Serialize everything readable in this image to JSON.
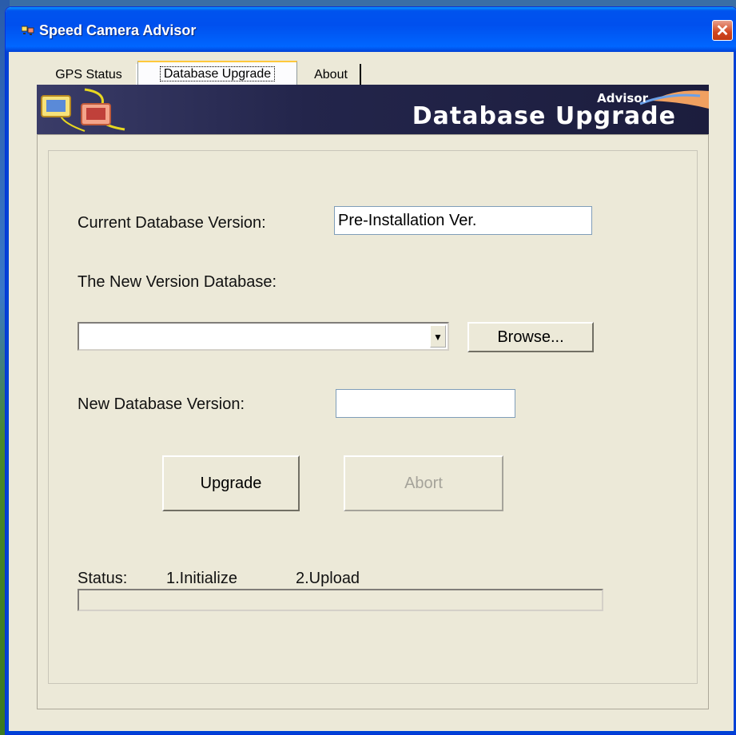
{
  "window": {
    "title": "Speed Camera Advisor",
    "close_glyph": "✕"
  },
  "tabs": [
    {
      "label": "GPS Status",
      "active": false
    },
    {
      "label": "Database Upgrade",
      "active": true
    },
    {
      "label": "About",
      "active": false
    }
  ],
  "banner": {
    "subtitle": "Advisor",
    "title": "Database Upgrade",
    "icon": "monitors-logo-icon"
  },
  "form": {
    "current_version_label": "Current Database Version:",
    "current_version_value": "Pre-Installation Ver.",
    "new_database_label": "The New Version Database:",
    "new_database_value": "",
    "browse_label": "Browse...",
    "new_version_label": "New Database Version:",
    "new_version_value": "",
    "upgrade_label": "Upgrade",
    "abort_label": "Abort"
  },
  "status": {
    "label": "Status:",
    "step1": "1.Initialize",
    "step2": "2.Upload",
    "progress": 0
  },
  "colors": {
    "titlebar": "#0053ee",
    "window_bg": "#ece9d8",
    "banner_bg": "#23254b",
    "close_button": "#d1461f"
  }
}
